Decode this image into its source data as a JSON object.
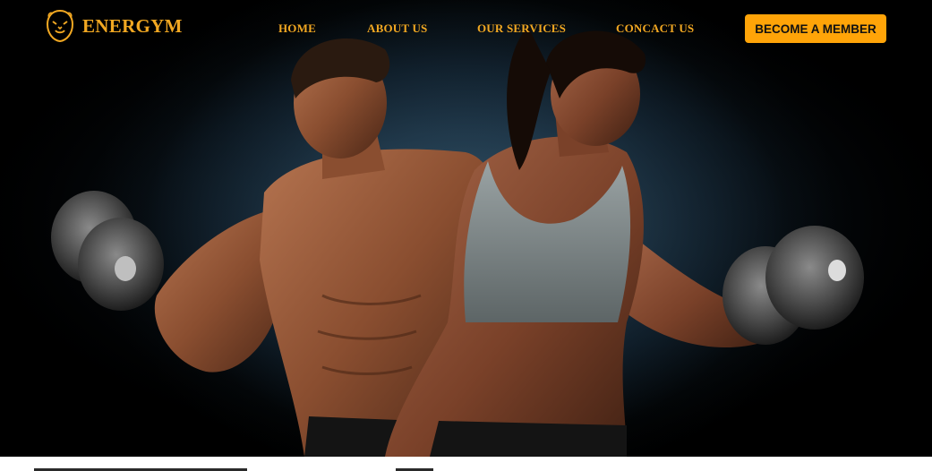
{
  "brand": {
    "name": "ENERGYM",
    "logo_icon": "lion-head-icon",
    "accent_color": "#f2a822"
  },
  "nav": {
    "items": [
      {
        "label": "HOME"
      },
      {
        "label": "ABOUT US"
      },
      {
        "label": "OUR SERVICES"
      },
      {
        "label": "CONCACT US"
      }
    ],
    "cta_label": "BECOME A MEMBER",
    "cta_color": "#ffa408"
  },
  "hero": {
    "image": "hero-photo-man-and-woman-lifting-dumbbells"
  }
}
